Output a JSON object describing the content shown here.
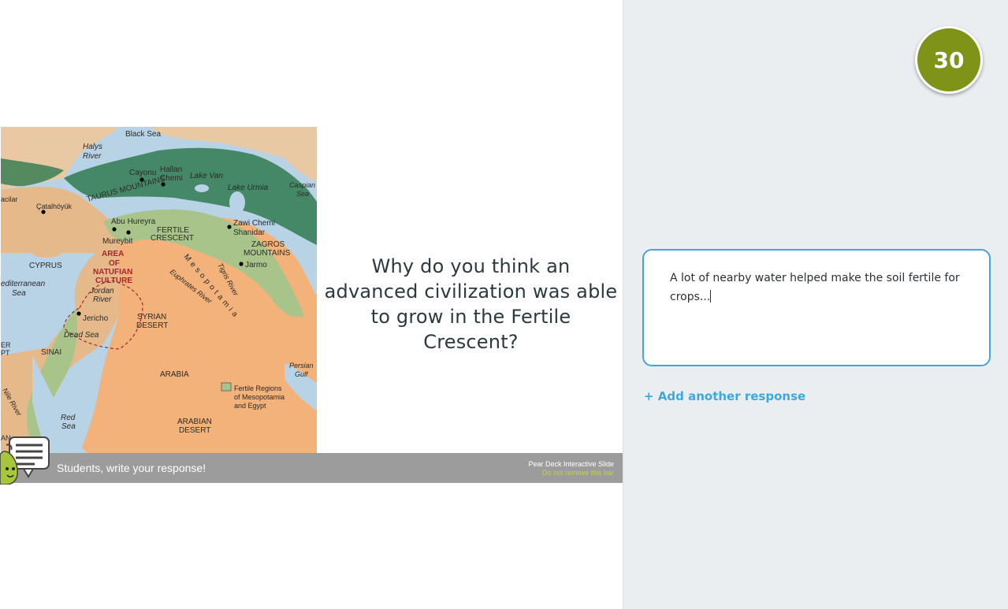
{
  "slide": {
    "question": "Why do you think an advanced civilization was able to grow in the Fertile Crescent?",
    "bar_prompt": "Students, write your response!",
    "brand_line1": "Pear Deck Interactive Slide",
    "brand_line2": "Do not remove this bar"
  },
  "map": {
    "labels": {
      "black_sea": "Black Sea",
      "halys": "Halys",
      "halys2": "River",
      "cayonu": "Cayonu",
      "hallan": "Hallan",
      "chemi": "Chemi",
      "lake_van": "Lake Van",
      "lake_urmia": "Lake Urmia",
      "caspian": "Caspian",
      "caspian2": "Sea",
      "acilar": "acilar",
      "catalhoyuk": "Çatalhöyük",
      "taurus": "TAURUS MOUNTAINS",
      "abu": "Abu Hureyra",
      "mureybit": "Mureybit",
      "fertile": "FERTILE",
      "crescent": "CRESCENT",
      "zawi": "Zawi Chemi",
      "shanidar": "Shanidar",
      "zagros": "ZAGROS",
      "mountains": "MOUNTAINS",
      "cyprus": "CYPRUS",
      "area": "AREA",
      "of": "OF",
      "natufian": "NATUFIAN",
      "culture": "CULTURE",
      "mesopotamia": "Mesopotamia",
      "tigris": "Tigris River",
      "euphrates": "Euphrates River",
      "jarmo": "Jarmo",
      "mediterranean": "editerranean",
      "med_sea": "Sea",
      "jordan": "Jordan",
      "jordan2": "River",
      "jericho": "Jericho",
      "dead_sea": "Dead Sea",
      "syrian": "SYRIAN",
      "desert": "DESERT",
      "sinai": "SINAI",
      "persian": "Persian",
      "gulf": "Gulf",
      "arabia": "ARABIA",
      "legend1": "Fertile Regions",
      "legend2": "of Mesopotamia",
      "legend3": "and Egypt",
      "nile": "Nile River",
      "red_sea": "Red",
      "red_sea2": "Sea",
      "arabian": "ARABIAN",
      "arabian_desert": "DESERT",
      "egypt_er": "ER",
      "egypt_pt": "PT",
      "egypt_an": "AN"
    }
  },
  "timer": {
    "value": "30"
  },
  "response": {
    "text": "A lot of nearby water helped make the soil fertile for crops...",
    "add_label": "+ Add another response"
  },
  "colors": {
    "accent": "#3fa7dd",
    "timer_bg": "#7e9317",
    "panel_bg": "#eaeef1",
    "bar_bg": "#9c9c9c",
    "brand_green": "#c6d33d"
  }
}
